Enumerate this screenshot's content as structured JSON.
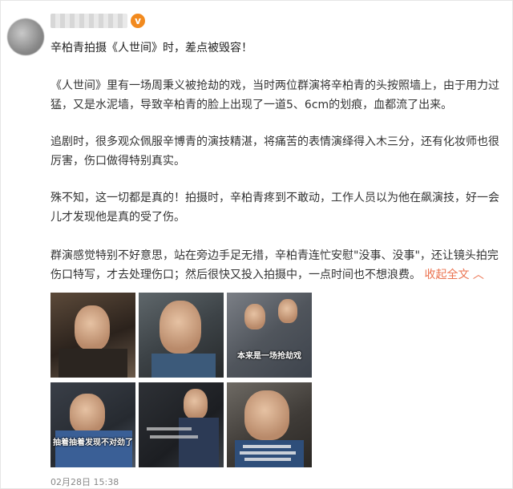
{
  "post": {
    "title": "辛柏青拍摄《人世间》时，差点被毁容！",
    "paragraphs": [
      "《人世间》里有一场周秉义被抢劫的戏，当时两位群演将辛柏青的头按照墙上，由于用力过猛，又是水泥墙，导致辛柏青的脸上出现了一道5、6cm的划痕，血都流了出来。",
      "追剧时，很多观众佩服辛博青的演技精湛，将痛苦的表情演绎得入木三分，还有化妆师也很厉害，伤口做得特别真实。",
      "殊不知，这一切都是真的！拍摄时，辛柏青疼到不敢动，工作人员以为他在飙演技，好一会儿才发现他是真的受了伤。",
      "群演感觉特别不好意思，站在旁边手足无措，辛柏青连忙安慰\"没事、没事\"，还让镜头拍完伤口特写，才去处理伤口；然后很快又投入拍摄中，一点时间也不想浪费。"
    ],
    "collapse_link": "收起全文",
    "timestamp": "02月28日 15:38",
    "verified_icon": "verified-badge-icon",
    "image_captions": {
      "img3": "本来是一场抢劫戏",
      "img4": "抽着抽着发现不对劲了"
    }
  }
}
